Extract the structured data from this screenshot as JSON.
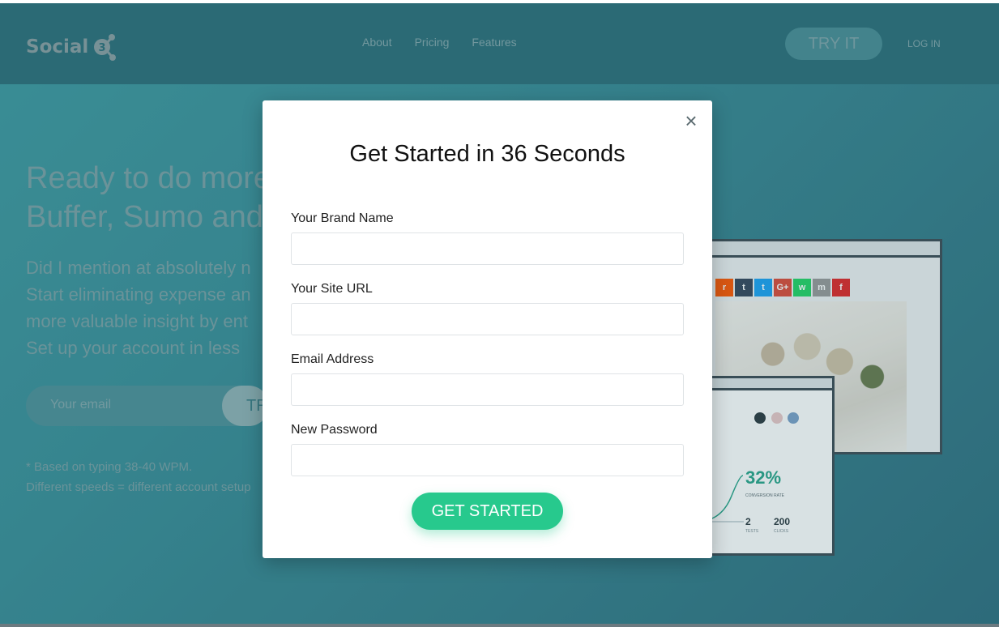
{
  "header": {
    "logo_text": "Social",
    "logo_badge": "3",
    "nav": [
      "About",
      "Pricing",
      "Features"
    ],
    "try_it": "TRY IT",
    "login": "LOG IN"
  },
  "hero": {
    "title_lines": [
      "Ready to do more",
      "Buffer, Sumo and"
    ],
    "body_lines": [
      "Did I mention at absolutely n",
      "Start eliminating expense an",
      "more valuable insight by ent",
      "Set up your account in less"
    ],
    "email_placeholder": "Your email",
    "try_partial": "TR",
    "footnote_lines": [
      "* Based on typing 38-40 WPM.",
      "Different speeds = different account setup"
    ]
  },
  "mock": {
    "share_icons": [
      "r",
      "t",
      "t",
      "G+",
      "w",
      "m",
      "f"
    ],
    "share_colors": [
      "#ff5700",
      "#35465c",
      "#1da1f2",
      "#dd4b39",
      "#25d366",
      "#999999",
      "#e12828"
    ],
    "percent": "32%",
    "percent_label": "CONVERSION RATE",
    "stat1_value": "2",
    "stat1_label": "TESTS",
    "stat2_value": "200",
    "stat2_label": "CLICKS"
  },
  "modal": {
    "close_icon": "×",
    "title": "Get Started in 36 Seconds",
    "fields": [
      {
        "label": "Your Brand Name",
        "value": ""
      },
      {
        "label": "Your Site URL",
        "value": ""
      },
      {
        "label": "Email Address",
        "value": ""
      },
      {
        "label": "New Password",
        "value": ""
      }
    ],
    "submit_label": "GET STARTED"
  }
}
